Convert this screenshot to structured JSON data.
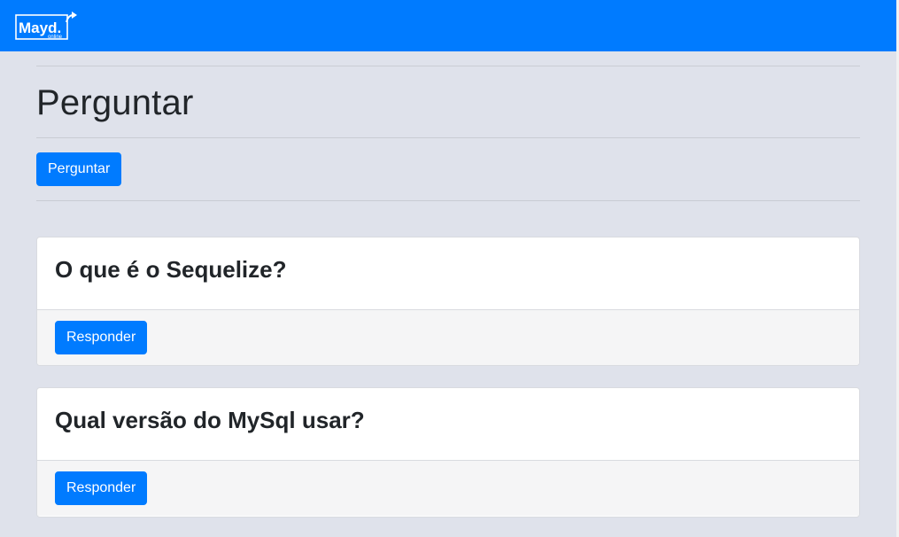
{
  "navbar": {
    "logo_text": "Mayd.",
    "logo_subtext": "online",
    "logo_icon": "share-arrow-icon"
  },
  "page": {
    "title": "Perguntar",
    "ask_button_label": "Perguntar"
  },
  "questions": [
    {
      "title": "O que é o Sequelize?",
      "reply_label": "Responder"
    },
    {
      "title": "Qual versão do MySql usar?",
      "reply_label": "Responder"
    }
  ],
  "colors": {
    "primary": "#007bff",
    "background": "#dfe2eb",
    "card_footer": "#f5f5f6"
  }
}
